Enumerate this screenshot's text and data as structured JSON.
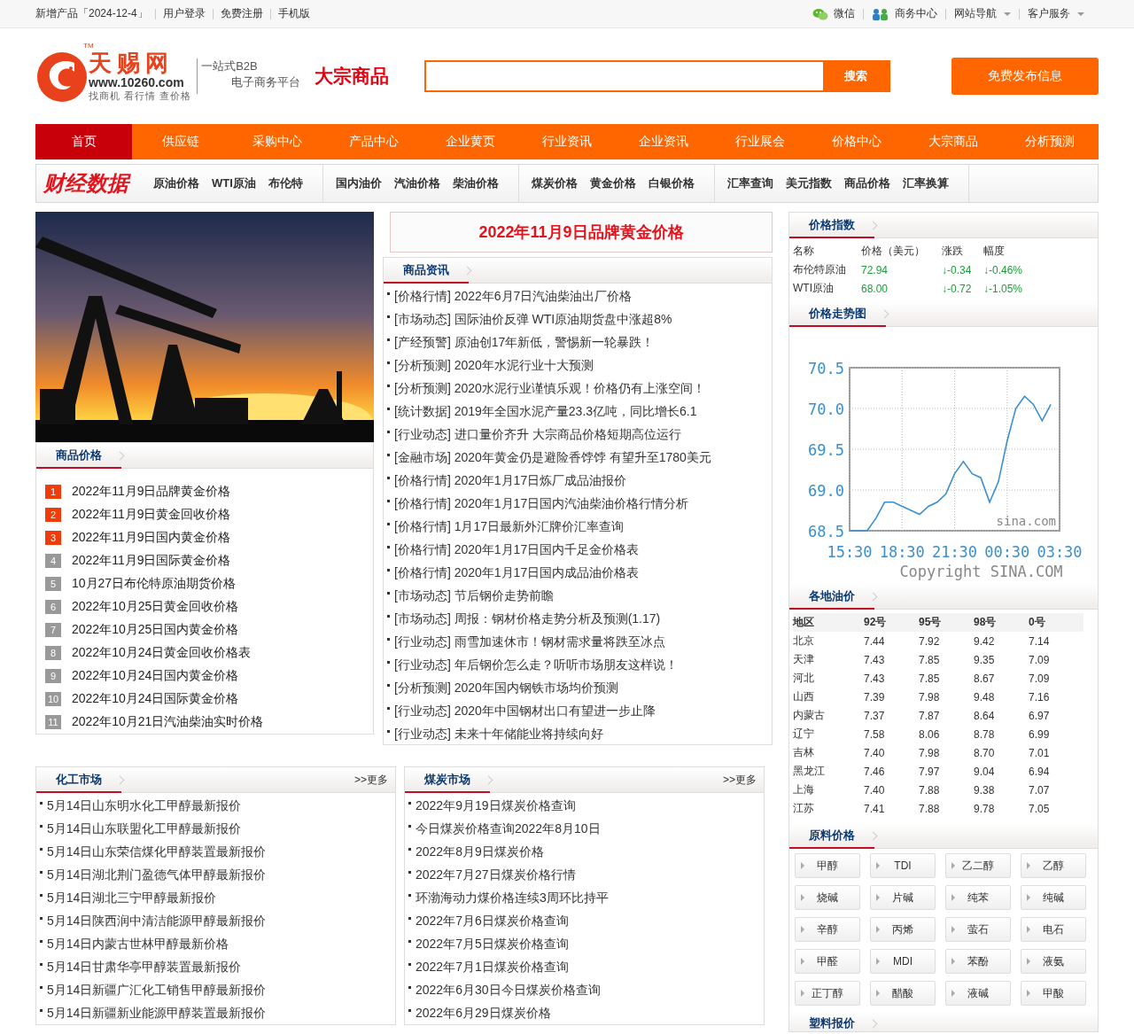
{
  "top_bar": {
    "left_links": [
      "新增产品「2024-12-4」",
      "用户登录",
      "免费注册",
      "手机版"
    ],
    "right_links": [
      {
        "label": "微信",
        "kind": "wechat"
      },
      {
        "label": "商务中心",
        "kind": "group"
      },
      {
        "label": "网站导航",
        "kind": "dropdown"
      },
      {
        "label": "客户服务",
        "kind": "dropdown"
      }
    ]
  },
  "header": {
    "logo": {
      "name": "天赐网",
      "tm": "TM",
      "url": "www.10260.com",
      "tagline": "找商机 看行情 查价格"
    },
    "slogan": [
      "一站式B2B",
      "电子商务平台"
    ],
    "channel": "大宗商品",
    "search_button": "搜索",
    "publish_button": "免费发布信息"
  },
  "nav": [
    {
      "label": "首页",
      "selected": true
    },
    {
      "label": "供应链",
      "selected": false
    },
    {
      "label": "采购中心",
      "selected": false
    },
    {
      "label": "产品中心",
      "selected": false
    },
    {
      "label": "企业黄页",
      "selected": false
    },
    {
      "label": "行业资讯",
      "selected": false
    },
    {
      "label": "企业资讯",
      "selected": false
    },
    {
      "label": "行业展会",
      "selected": false
    },
    {
      "label": "价格中心",
      "selected": false
    },
    {
      "label": "大宗商品",
      "selected": false
    },
    {
      "label": "分析预测",
      "selected": false
    }
  ],
  "finance_bar": {
    "title": "财经数据",
    "groups": [
      [
        "原油价格",
        "WTI原油",
        "布伦特"
      ],
      [
        "国内油价",
        "汽油价格",
        "柴油价格"
      ],
      [
        "煤炭价格",
        "黄金价格",
        "白银价格"
      ],
      [
        "汇率查询",
        "美元指数",
        "商品价格",
        "汇率换算"
      ]
    ]
  },
  "featured": {
    "headline": "2022年11月9日品牌黄金价格"
  },
  "commodity_prices": {
    "title": "商品价格",
    "items": [
      {
        "rank": "1",
        "text": "2022年11月9日品牌黄金价格",
        "hot": true
      },
      {
        "rank": "2",
        "text": "2022年11月9日黄金回收价格",
        "hot": true
      },
      {
        "rank": "3",
        "text": "2022年11月9日国内黄金价格",
        "hot": true
      },
      {
        "rank": "4",
        "text": "2022年11月9日国际黄金价格",
        "hot": false
      },
      {
        "rank": "5",
        "text": "10月27日布伦特原油期货价格",
        "hot": false
      },
      {
        "rank": "6",
        "text": "2022年10月25日黄金回收价格",
        "hot": false
      },
      {
        "rank": "7",
        "text": "2022年10月25日国内黄金价格",
        "hot": false
      },
      {
        "rank": "8",
        "text": "2022年10月24日黄金回收价格表",
        "hot": false
      },
      {
        "rank": "9",
        "text": "2022年10月24日国内黄金价格",
        "hot": false
      },
      {
        "rank": "10",
        "text": "2022年10月24日国际黄金价格",
        "hot": false
      },
      {
        "rank": "11",
        "text": "2022年10月21日汽油柴油实时价格",
        "hot": false
      }
    ]
  },
  "news": {
    "title": "商品资讯",
    "items": [
      "[价格行情] 2022年6月7日汽油柴油出厂价格",
      "[市场动态] 国际油价反弹 WTI原油期货盘中涨超8%",
      "[产经预警] 原油创17年新低，警惕新一轮暴跌！",
      "[分析预测] 2020年水泥行业十大预测",
      "[分析预测] 2020水泥行业谨慎乐观！价格仍有上涨空间！",
      "[统计数据] 2019年全国水泥产量23.3亿吨，同比增长6.1",
      "[行业动态] 进口量价齐升 大宗商品价格短期高位运行",
      "[金融市场] 2020年黄金仍是避险香饽饽 有望升至1780美元",
      "[价格行情] 2020年1月17日炼厂成品油报价",
      "[价格行情] 2020年1月17日国内汽油柴油价格行情分析",
      "[价格行情] 1月17日最新外汇牌价汇率查询",
      "[价格行情] 2020年1月17日国内千足金价格表",
      "[价格行情] 2020年1月17日国内成品油价格表",
      "[市场动态] 节后钢价走势前瞻",
      "[市场动态] 周报：钢材价格走势分析及预测(1.17)",
      "[行业动态] 雨雪加速休市！钢材需求量将跌至冰点",
      "[行业动态] 年后钢价怎么走？听听市场朋友这样说！",
      "[分析预测] 2020年国内钢铁市场均价预测",
      "[行业动态] 2020年中国钢材出口有望进一步止降",
      "[行业动态] 未来十年储能业将持续向好"
    ]
  },
  "markets": [
    {
      "title": "化工市场",
      "more": ">>更多",
      "items": [
        "5月14日山东明水化工甲醇最新报价",
        "5月14日山东联盟化工甲醇最新报价",
        "5月14日山东荣信煤化甲醇装置最新报价",
        "5月14日湖北荆门盈德气体甲醇最新报价",
        "5月14日湖北三宁甲醇最新报价",
        "5月14日陕西润中清洁能源甲醇最新报价",
        "5月14日内蒙古世林甲醇最新价格",
        "5月14日甘肃华亭甲醇装置最新报价",
        "5月14日新疆广汇化工销售甲醇最新报价",
        "5月14日新疆新业能源甲醇装置最新报价"
      ]
    },
    {
      "title": "煤炭市场",
      "more": ">>更多",
      "items": [
        "2022年9月19日煤炭价格查询",
        "今日煤炭价格查询2022年8月10日",
        "2022年8月9日煤炭价格",
        "2022年7月27日煤炭价格行情",
        "环渤海动力煤价格连续3周环比持平",
        "2022年7月6日煤炭价格查询",
        "2022年7月5日煤炭价格查询",
        "2022年7月1日煤炭价格查询",
        "2022年6月30日今日煤炭价格查询",
        "2022年6月29日煤炭价格"
      ]
    }
  ],
  "price_index": {
    "title": "价格指数",
    "columns": [
      "名称",
      "价格（美元）",
      "涨跌",
      "幅度"
    ],
    "rows": [
      {
        "name": "布伦特原油",
        "price": "72.94",
        "change": "↓-0.34",
        "percent": "↓-0.46%"
      },
      {
        "name": "WTI原油",
        "price": "68.00",
        "change": "↓-0.72",
        "percent": "↓-1.05%"
      }
    ]
  },
  "price_trend": {
    "title": "价格走势图",
    "copyright": "Copyright SINA.COM",
    "chart_data": {
      "type": "line",
      "categories": [
        "15:30",
        null,
        null,
        null,
        null,
        null,
        "18:30",
        null,
        null,
        null,
        null,
        null,
        "21:30",
        null,
        null,
        null,
        null,
        null,
        "00:30",
        null,
        null,
        null,
        null,
        null,
        "03:30"
      ],
      "grid": true,
      "series": [
        {
          "color": "#3a8fd0",
          "values": [
            68.5,
            68.5,
            68.5,
            68.65,
            68.85,
            68.85,
            68.8,
            68.75,
            68.7,
            68.8,
            68.85,
            68.95,
            69.2,
            69.35,
            69.2,
            69.15,
            68.85,
            69.1,
            69.6,
            70.0,
            70.15,
            70.05,
            69.85,
            70.05,
            null
          ]
        }
      ],
      "ylim": [
        68.5,
        70.5
      ],
      "yticks": [
        68.5,
        {
          "value": 69,
          "label": "69.0"
        },
        69.5,
        {
          "value": 70,
          "label": "70.0"
        },
        70.5
      ],
      "annotations": [
        "sina.com"
      ]
    }
  },
  "oil_prices": {
    "title": "各地油价",
    "columns": [
      "地区",
      "92号",
      "95号",
      "98号",
      "0号"
    ],
    "rows": [
      [
        "北京",
        "7.44",
        "7.92",
        "9.42",
        "7.14"
      ],
      [
        "天津",
        "7.43",
        "7.85",
        "9.35",
        "7.09"
      ],
      [
        "河北",
        "7.43",
        "7.85",
        "8.67",
        "7.09"
      ],
      [
        "山西",
        "7.39",
        "7.98",
        "9.48",
        "7.16"
      ],
      [
        "内蒙古",
        "7.37",
        "7.87",
        "8.64",
        "6.97"
      ],
      [
        "辽宁",
        "7.58",
        "8.06",
        "8.78",
        "6.99"
      ],
      [
        "吉林",
        "7.40",
        "7.98",
        "8.70",
        "7.01"
      ],
      [
        "黑龙江",
        "7.46",
        "7.97",
        "9.04",
        "6.94"
      ],
      [
        "上海",
        "7.40",
        "7.88",
        "9.38",
        "7.07"
      ],
      [
        "江苏",
        "7.41",
        "7.88",
        "9.78",
        "7.05"
      ]
    ]
  },
  "materials": {
    "title": "原料价格",
    "items": [
      "甲醇",
      "TDI",
      "乙二醇",
      "乙醇",
      "烧碱",
      "片碱",
      "纯苯",
      "纯碱",
      "辛醇",
      "丙烯",
      "萤石",
      "电石",
      "甲醛",
      "MDI",
      "苯酚",
      "液氨",
      "正丁醇",
      "醋酸",
      "液碱",
      "甲酸"
    ]
  },
  "plastics": {
    "title": "塑料报价"
  }
}
